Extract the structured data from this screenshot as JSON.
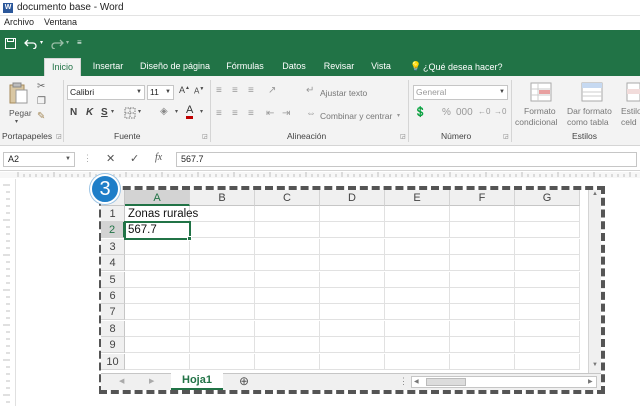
{
  "window": {
    "title": "documento base - Word"
  },
  "menu": {
    "items": [
      "Archivo",
      "Ventana"
    ]
  },
  "tabs": [
    "Inicio",
    "Insertar",
    "Diseño de página",
    "Fórmulas",
    "Datos",
    "Revisar",
    "Vista"
  ],
  "tell_me": "¿Qué desea hacer?",
  "ribbon": {
    "clipboard": {
      "paste": "Pegar",
      "label": "Portapapeles"
    },
    "font": {
      "name": "Calibri",
      "size": "11",
      "bold": "N",
      "italic": "K",
      "underline": "S",
      "label": "Fuente",
      "font_color": "#c00000"
    },
    "alignment": {
      "wrap": "Ajustar texto",
      "merge": "Combinar y centrar",
      "label": "Alineación"
    },
    "number": {
      "format": "General",
      "label": "Número"
    },
    "styles": {
      "cond_format_1": "Formato",
      "cond_format_2": "condicional",
      "table_format_1": "Dar formato",
      "table_format_2": "como tabla",
      "cell_styles_1": "Estilo",
      "cell_styles_2": "celd",
      "label": "Estilos"
    }
  },
  "formula_bar": {
    "name_box": "A2",
    "fx": "fx",
    "value": "567.7"
  },
  "sheet": {
    "columns": [
      "A",
      "B",
      "C",
      "D",
      "E",
      "F",
      "G"
    ],
    "rows": [
      "1",
      "2",
      "3",
      "4",
      "5",
      "6",
      "7",
      "8",
      "9",
      "10"
    ],
    "cells": {
      "A1": "Zonas rurales",
      "A2": "567.7"
    },
    "active_cell": "A2",
    "tab_name": "Hoja1"
  },
  "callout": {
    "number": "3"
  },
  "colors": {
    "accent": "#217346",
    "badge": "#1e7ec8"
  }
}
